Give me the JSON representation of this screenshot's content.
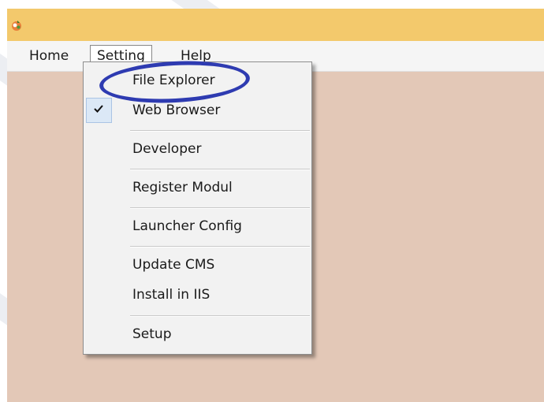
{
  "menubar": {
    "home": "Home",
    "setting": "Setting",
    "help": "Help"
  },
  "dropdown": {
    "items": [
      {
        "label": "File Explorer",
        "checked": false
      },
      {
        "label": "Web Browser",
        "checked": true
      },
      {
        "label": "Developer",
        "checked": false
      },
      {
        "label": "Register Modul",
        "checked": false
      },
      {
        "label": "Launcher Config",
        "checked": false
      },
      {
        "label": "Update CMS",
        "checked": false
      },
      {
        "label": "Install in IIS",
        "checked": false
      },
      {
        "label": "Setup",
        "checked": false
      }
    ]
  },
  "icons": {
    "app": "app-icon",
    "check": "check-icon"
  },
  "colors": {
    "titlebar": "#f3c96c",
    "client_area": "#e3c8b7",
    "annotation": "#2e3bb1"
  }
}
